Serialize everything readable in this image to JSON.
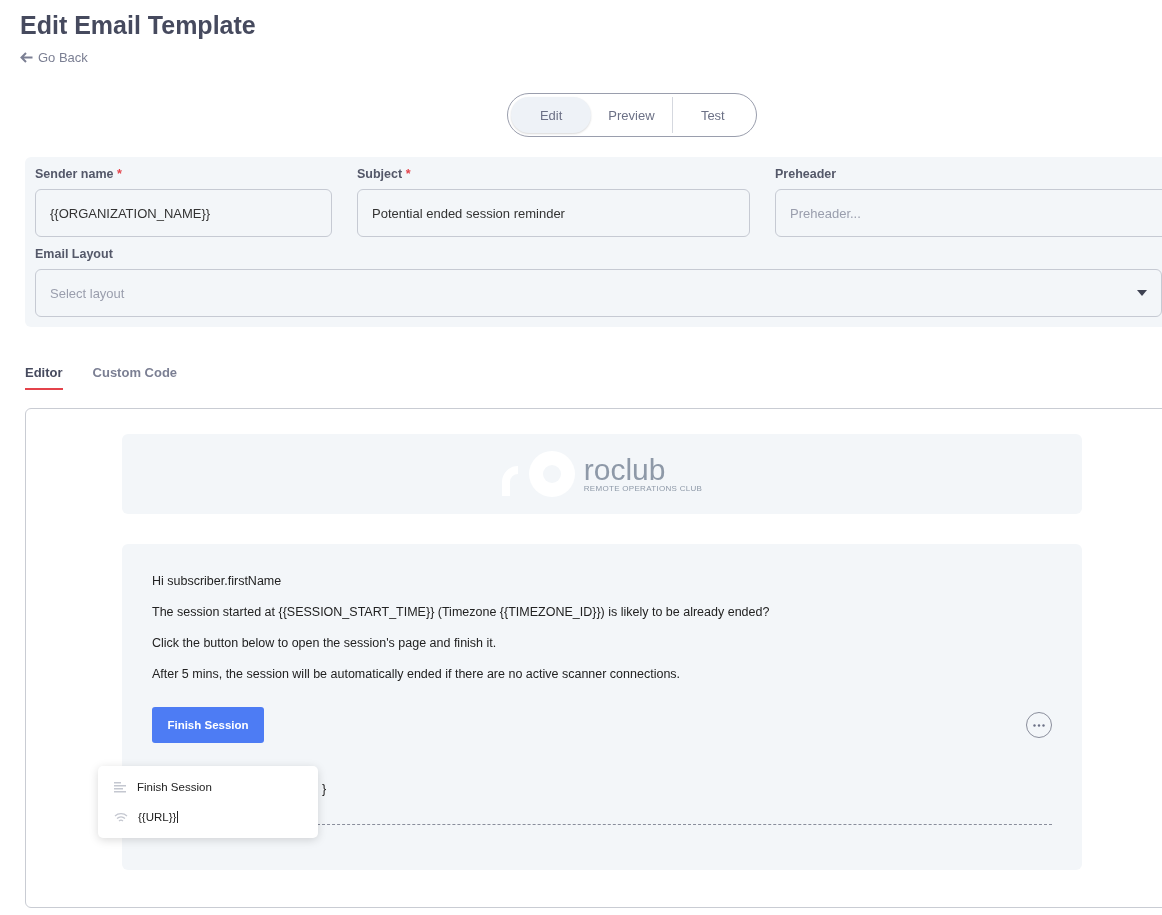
{
  "page": {
    "title": "Edit Email Template",
    "back_link": "Go Back"
  },
  "mode_tabs": [
    {
      "label": "Edit",
      "selected": true
    },
    {
      "label": "Preview",
      "selected": false
    },
    {
      "label": "Test",
      "selected": false
    }
  ],
  "form": {
    "fields": [
      {
        "label": "Sender name",
        "required": true,
        "value": "{{ORGANIZATION_NAME}}"
      },
      {
        "label": "Subject",
        "required": true,
        "value": "Potential ended session reminder"
      },
      {
        "label": "Preheader",
        "required": false,
        "placeholder": "Preheader..."
      }
    ],
    "layout": {
      "label": "Email Layout",
      "placeholder": "Select layout"
    },
    "required_mark": "*"
  },
  "editor_tabs": [
    {
      "label": "Editor",
      "selected": true
    },
    {
      "label": "Custom Code",
      "selected": false
    }
  ],
  "email": {
    "logo": {
      "name": "roclub",
      "tagline": "REMOTE OPERATIONS CLUB"
    },
    "paragraphs": [
      "Hi subscriber.firstName",
      "The session started at {{SESSION_START_TIME}} (Timezone {{TIMEZONE_ID}}) is likely to be already ended?",
      "Click the button below to open the session's page and finish it.",
      "After 5 mins, the session will be automatically ended if there are no active scanner connections."
    ],
    "button": "Finish Session",
    "hidden_line_tail": "}",
    "popover": [
      {
        "kind": "text",
        "value": "Finish Session"
      },
      {
        "kind": "link",
        "value": "{{URL}}"
      }
    ]
  }
}
